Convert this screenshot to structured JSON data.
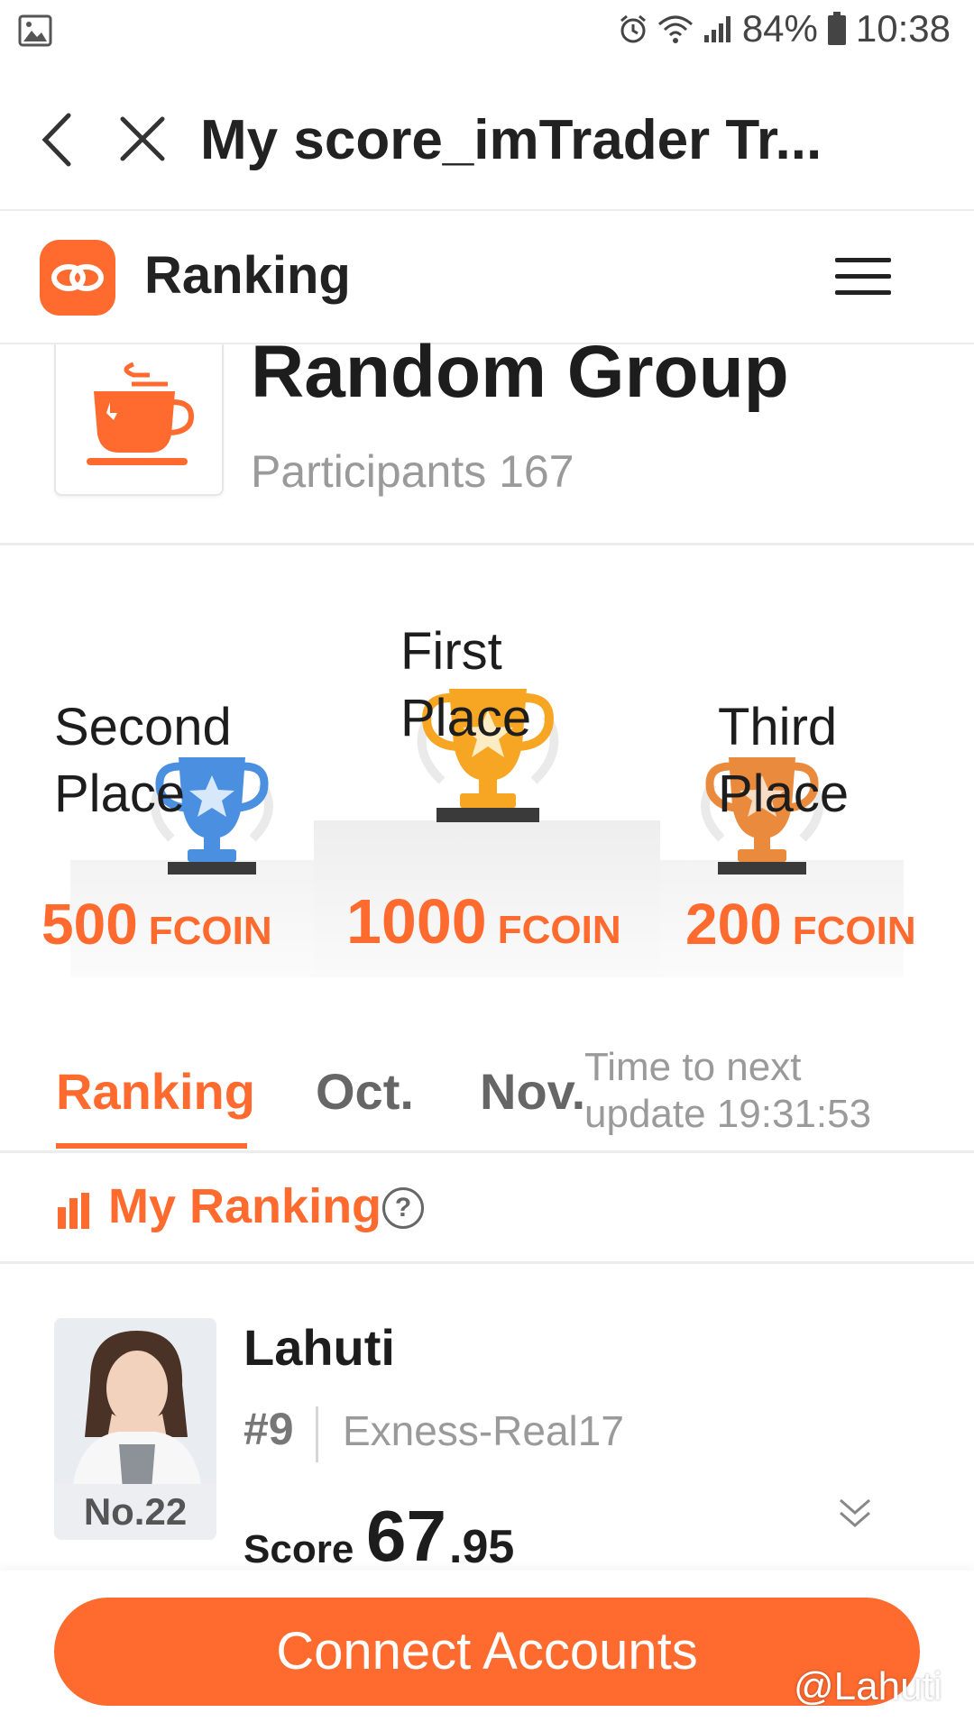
{
  "status_bar": {
    "battery": "84%",
    "time": "10:38"
  },
  "title_bar": {
    "title": "My score_imTrader Tr..."
  },
  "app_header": {
    "name": "Ranking"
  },
  "group": {
    "name": "Random Group",
    "participants": "Participants 167"
  },
  "podium": {
    "first": {
      "label_line1": "First",
      "label_line2": "Place",
      "amount": "1000",
      "unit": "FCOIN"
    },
    "second": {
      "label_line1": "Second",
      "label_line2": "Place",
      "amount": "500",
      "unit": "FCOIN"
    },
    "third": {
      "label_line1": "Third",
      "label_line2": "Place",
      "amount": "200",
      "unit": "FCOIN"
    }
  },
  "tabs": {
    "ranking": "Ranking",
    "oct": "Oct.",
    "nov": "Nov.",
    "update_line1": "Time to next",
    "update_line2": "update 19:31:53"
  },
  "my_ranking": {
    "label": "My Ranking",
    "help": "?"
  },
  "user": {
    "name": "Lahuti",
    "position": "#9",
    "account": "Exness-Real17",
    "rank_badge": "No.22",
    "score_label": "Score",
    "score_int": "67",
    "score_dec": ".95"
  },
  "bottom": {
    "connect_label": "Connect Accounts",
    "watermark": "@Lahuti"
  },
  "colors": {
    "accent": "#ff6a2f",
    "gold": "#f6a623",
    "silver_blue": "#4a8fe0",
    "bronze": "#e98a3c"
  }
}
